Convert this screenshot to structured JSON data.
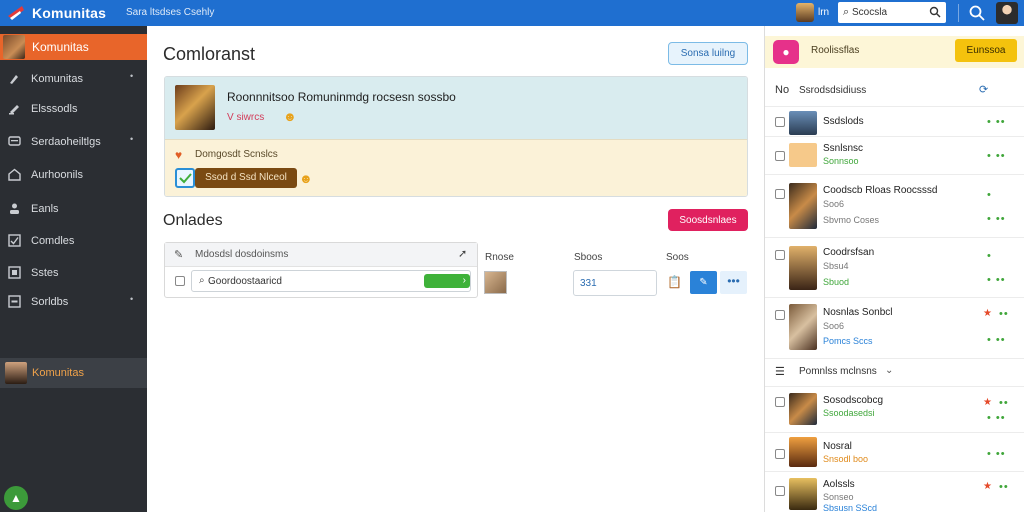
{
  "topbar": {
    "brand": "Komunitas",
    "tagline": "Sara ltsdses Csehly",
    "user": "lrn",
    "search_value": "Scocsla"
  },
  "sidebar": {
    "header_label": "Komunitas",
    "items": [
      {
        "label": "Komunitas",
        "icon": "community-icon",
        "caret": true
      },
      {
        "label": "Elsssodls",
        "icon": "pencil-icon",
        "caret": false
      },
      {
        "label": "Serdaoheiltlgs",
        "icon": "chat-icon",
        "caret": true
      },
      {
        "label": "Aurhoonils",
        "icon": "home-icon",
        "caret": false
      },
      {
        "label": "Eanls",
        "icon": "user-icon",
        "caret": false
      },
      {
        "label": "Comdles",
        "icon": "checkbox-icon",
        "caret": false
      },
      {
        "label": "Sstes",
        "icon": "grid-icon",
        "caret": false
      },
      {
        "label": "Sorldbs",
        "icon": "settings-icon",
        "caret": true
      }
    ],
    "active_label": "Komunitas"
  },
  "main": {
    "title": "Comloranst",
    "top_button": "Sonsa luilng",
    "card": {
      "title": "Roonnnitsoo Romuninmdg rocsesn sossbo",
      "meta": "V siwrcs",
      "sub": "Domgosdt Scnslcs",
      "pill": "Ssod d Ssd Nlceol"
    },
    "section_title": "Onlades",
    "pink_button": "Soosdsnlaes",
    "table": {
      "header": "Mdosdsl dosdoinsms",
      "input_value": "Goordoostaaricd"
    },
    "columns": {
      "c1": "Rnose",
      "c2": "Sboos",
      "c3": "Soos"
    },
    "field_value": "331"
  },
  "right_panel": {
    "top_label": "Roolissflas",
    "top_button": "Eunssoa",
    "head1": "Ssrodsdsidiuss",
    "head1_icon": "No",
    "head2": "Pomnlss mclnsns",
    "rows": [
      {
        "name": "Ssdslods",
        "meta": "",
        "sub": ""
      },
      {
        "name": "Ssnlsnsc",
        "meta": "",
        "sub": "Sonnsoo"
      },
      {
        "name": "Coodscb Rloas Roocsssd",
        "meta": "Soo6",
        "sub": "Sbvmo Coses"
      },
      {
        "name": "Coodrsfsan",
        "meta": "Sbsu4",
        "sub": "Sbuod"
      },
      {
        "name": "Nosnlas Sonbcl",
        "meta": "Soo6",
        "sub": "Pomcs Sccs"
      },
      {
        "name": "Sosodscobcg",
        "meta": "",
        "sub": "Ssoodasedsi"
      },
      {
        "name": "Nosral",
        "meta": "",
        "sub": "Snsodl boo"
      },
      {
        "name": "Aolssls",
        "meta": "Sonseo",
        "sub": "Sbsusn SScd"
      }
    ]
  }
}
